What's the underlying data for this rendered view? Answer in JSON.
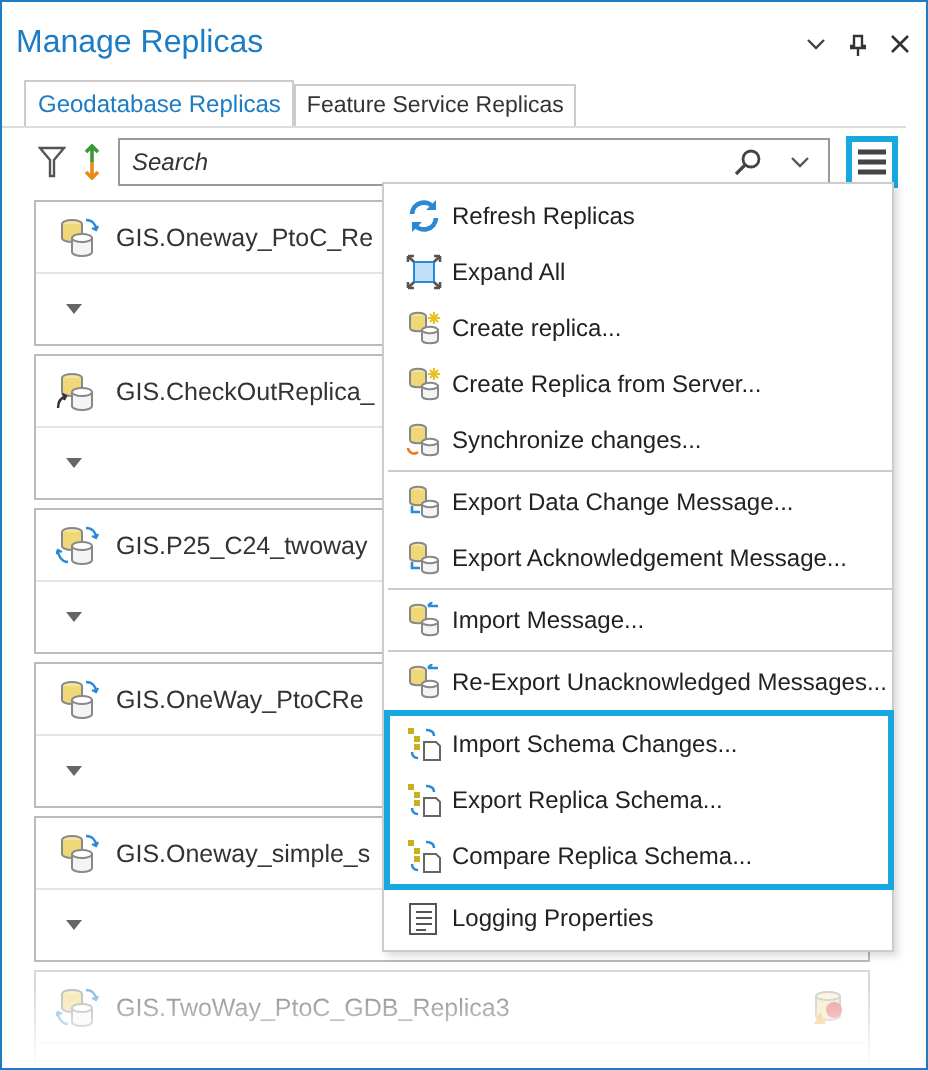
{
  "window": {
    "title": "Manage Replicas"
  },
  "tabs": [
    {
      "label": "Geodatabase Replicas",
      "selected": true
    },
    {
      "label": "Feature Service Replicas",
      "selected": false
    }
  ],
  "toolbar": {
    "search": {
      "placeholder": "Search"
    },
    "menu_button_highlighted": true
  },
  "replicas": [
    {
      "name": "GIS.Oneway_PtoC_Re",
      "kind": "oneway",
      "faded": false
    },
    {
      "name": "GIS.CheckOutReplica_",
      "kind": "checkout",
      "faded": false
    },
    {
      "name": "GIS.P25_C24_twoway",
      "kind": "twoway",
      "faded": false
    },
    {
      "name": "GIS.OneWay_PtoCRe",
      "kind": "oneway",
      "faded": false
    },
    {
      "name": "GIS.Oneway_simple_s",
      "kind": "oneway",
      "faded": false
    },
    {
      "name": "GIS.TwoWay_PtoC_GDB_Replica3",
      "kind": "twoway",
      "faded": true,
      "warning": true
    }
  ],
  "menu": {
    "groups": [
      {
        "highlighted": false,
        "items": [
          {
            "label": "Refresh Replicas",
            "kind": "refresh"
          },
          {
            "label": "Expand All",
            "kind": "expand"
          },
          {
            "label": "Create replica...",
            "kind": "create"
          },
          {
            "label": "Create Replica from Server...",
            "kind": "create"
          },
          {
            "label": "Synchronize changes...",
            "kind": "sync"
          }
        ]
      },
      {
        "highlighted": false,
        "items": [
          {
            "label": "Export Data Change Message...",
            "kind": "export"
          },
          {
            "label": "Export Acknowledgement Message...",
            "kind": "export"
          }
        ]
      },
      {
        "highlighted": false,
        "items": [
          {
            "label": "Import Message...",
            "kind": "import"
          }
        ]
      },
      {
        "highlighted": false,
        "items": [
          {
            "label": "Re-Export Unacknowledged Messages...",
            "kind": "import"
          }
        ]
      },
      {
        "highlighted": true,
        "items": [
          {
            "label": "Import Schema Changes...",
            "kind": "schema"
          },
          {
            "label": "Export Replica Schema...",
            "kind": "schema"
          },
          {
            "label": "Compare Replica Schema...",
            "kind": "schema"
          }
        ]
      },
      {
        "highlighted": false,
        "items": [
          {
            "label": "Logging Properties",
            "kind": "log"
          }
        ]
      }
    ]
  }
}
